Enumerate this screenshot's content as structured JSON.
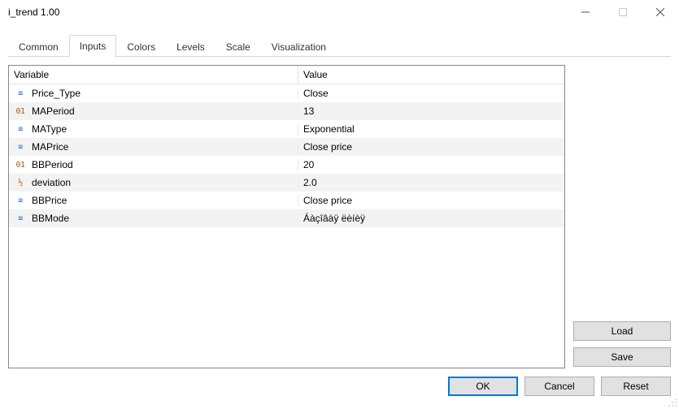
{
  "window": {
    "title": "i_trend 1.00"
  },
  "tabs": [
    {
      "label": "Common"
    },
    {
      "label": "Inputs",
      "active": true
    },
    {
      "label": "Colors"
    },
    {
      "label": "Levels"
    },
    {
      "label": "Scale"
    },
    {
      "label": "Visualization"
    }
  ],
  "headers": {
    "variable": "Variable",
    "value": "Value"
  },
  "rows": [
    {
      "type": "enum",
      "name": "Price_Type",
      "value": "Close"
    },
    {
      "type": "int",
      "name": "MAPeriod",
      "value": "13"
    },
    {
      "type": "enum",
      "name": "MAType",
      "value": "Exponential"
    },
    {
      "type": "enum",
      "name": "MAPrice",
      "value": "Close price"
    },
    {
      "type": "int",
      "name": "BBPeriod",
      "value": "20"
    },
    {
      "type": "float",
      "name": "deviation",
      "value": "2.0"
    },
    {
      "type": "enum",
      "name": "BBPrice",
      "value": "Close price"
    },
    {
      "type": "enum",
      "name": "BBMode",
      "value": "Áàçîâàÿ ëèíèÿ"
    }
  ],
  "buttons": {
    "load": "Load",
    "save": "Save",
    "ok": "OK",
    "cancel": "Cancel",
    "reset": "Reset"
  },
  "typeGlyph": {
    "enum": "≡",
    "int": "01",
    "float": "½"
  }
}
